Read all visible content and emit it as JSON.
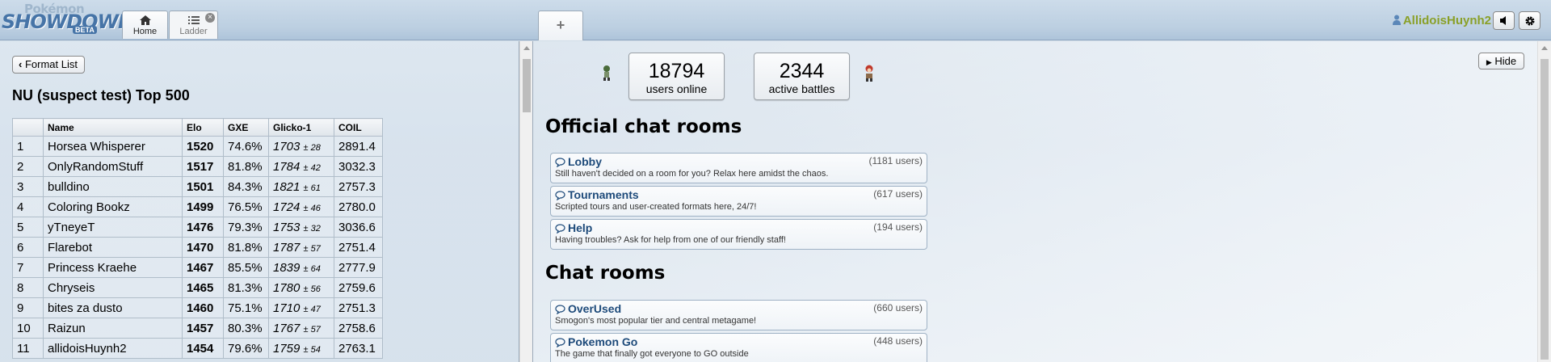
{
  "header": {
    "logo_top": "Pokémon",
    "logo_main": "SHOWDOWN",
    "logo_badge": "BETA",
    "tabs": [
      {
        "label": "Home",
        "icon": "home-icon"
      },
      {
        "label": "Ladder",
        "icon": "list-icon"
      }
    ],
    "new_tab_label": "+",
    "username": "AllidoisHuynh2",
    "sound_icon": "volume-icon",
    "settings_icon": "gear-icon"
  },
  "ladder": {
    "back_button": "Format List",
    "title": "NU (suspect test) Top 500",
    "columns": [
      "",
      "Name",
      "Elo",
      "GXE",
      "Glicko-1",
      "COIL"
    ],
    "rows": [
      {
        "rank": "1",
        "name": "Horsea Whisperer",
        "elo": "1520",
        "gxe": "74.6%",
        "glicko": "1703",
        "glicko_dev": "± 28",
        "coil": "2891.4"
      },
      {
        "rank": "2",
        "name": "OnlyRandomStuff",
        "elo": "1517",
        "gxe": "81.8%",
        "glicko": "1784",
        "glicko_dev": "± 42",
        "coil": "3032.3"
      },
      {
        "rank": "3",
        "name": "bulldino",
        "elo": "1501",
        "gxe": "84.3%",
        "glicko": "1821",
        "glicko_dev": "± 61",
        "coil": "2757.3"
      },
      {
        "rank": "4",
        "name": "Coloring Bookz",
        "elo": "1499",
        "gxe": "76.5%",
        "glicko": "1724",
        "glicko_dev": "± 46",
        "coil": "2780.0"
      },
      {
        "rank": "5",
        "name": "yTneyeT",
        "elo": "1476",
        "gxe": "79.3%",
        "glicko": "1753",
        "glicko_dev": "± 32",
        "coil": "3036.6"
      },
      {
        "rank": "6",
        "name": "Flarebot",
        "elo": "1470",
        "gxe": "81.8%",
        "glicko": "1787",
        "glicko_dev": "± 57",
        "coil": "2751.4"
      },
      {
        "rank": "7",
        "name": "Princess Kraehe",
        "elo": "1467",
        "gxe": "85.5%",
        "glicko": "1839",
        "glicko_dev": "± 64",
        "coil": "2777.9"
      },
      {
        "rank": "8",
        "name": "Chryseis",
        "elo": "1465",
        "gxe": "81.3%",
        "glicko": "1780",
        "glicko_dev": "± 56",
        "coil": "2759.6"
      },
      {
        "rank": "9",
        "name": "bites za dusto",
        "elo": "1460",
        "gxe": "75.1%",
        "glicko": "1710",
        "glicko_dev": "± 47",
        "coil": "2751.3"
      },
      {
        "rank": "10",
        "name": "Raizun",
        "elo": "1457",
        "gxe": "80.3%",
        "glicko": "1767",
        "glicko_dev": "± 57",
        "coil": "2758.6"
      },
      {
        "rank": "11",
        "name": "allidoisHuynh2",
        "elo": "1454",
        "gxe": "79.6%",
        "glicko": "1759",
        "glicko_dev": "± 54",
        "coil": "2763.1"
      }
    ]
  },
  "main": {
    "stats": {
      "users_online": "18794",
      "users_online_label": "users online",
      "active_battles": "2344",
      "active_battles_label": "active battles"
    },
    "hide_button": "Hide",
    "official_title": "Official chat rooms",
    "official_rooms": [
      {
        "name": "Lobby",
        "users": "(1181 users)",
        "desc": "Still haven't decided on a room for you? Relax here amidst the chaos."
      },
      {
        "name": "Tournaments",
        "users": "(617 users)",
        "desc": "Scripted tours and user-created formats here, 24/7!"
      },
      {
        "name": "Help",
        "users": "(194 users)",
        "desc": "Having troubles? Ask for help from one of our friendly staff!"
      }
    ],
    "chat_title": "Chat rooms",
    "chat_rooms": [
      {
        "name": "OverUsed",
        "users": "(660 users)",
        "desc": "Smogon's most popular tier and central metagame!"
      },
      {
        "name": "Pokemon Go",
        "users": "(448 users)",
        "desc": "The game that finally got everyone to GO outside"
      }
    ]
  }
}
